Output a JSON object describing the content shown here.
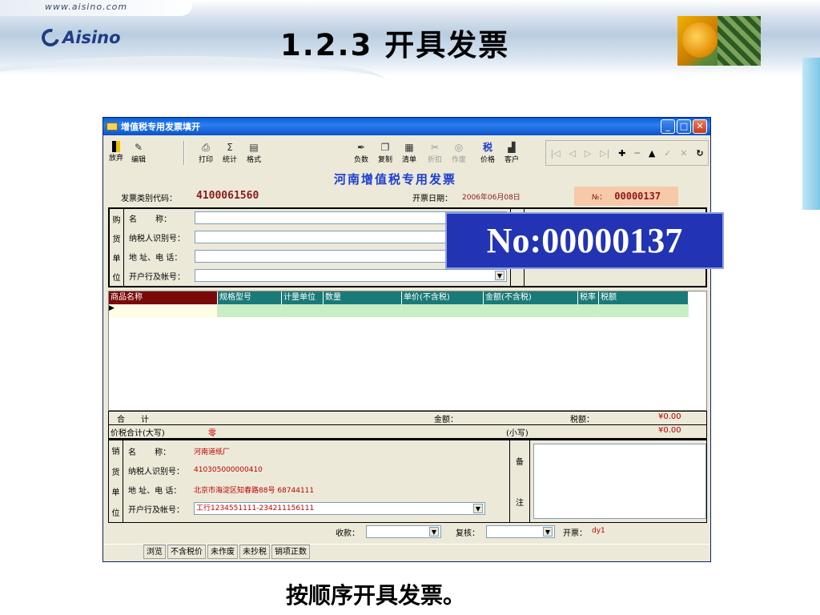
{
  "slide": {
    "url": "www.aisino.com",
    "logo": "Aisino",
    "title": "1.2.3 开具发票",
    "caption": "按顺序开具发票。"
  },
  "window": {
    "title": "增值税专用发票填开",
    "controls": {
      "minimize": "_",
      "maximize": "□",
      "close": "✕"
    }
  },
  "toolbar": {
    "discard": "放弃",
    "edit": "编辑",
    "print": "打印",
    "stats": "统计",
    "format": "格式",
    "negative": "负数",
    "copy": "复制",
    "list": "清单",
    "discount": "折扣",
    "void": "作废",
    "price": "价格",
    "customer": "客户",
    "nav_symbols": [
      "|◁",
      "◁",
      "▷",
      "▷|",
      "✚",
      "━",
      "▲",
      "✓",
      "✕",
      "↻"
    ]
  },
  "invoice": {
    "heading": "河南增值税专用发票",
    "code_label": "发票类别代码：",
    "code_value": "4100061560",
    "date_label": "开票日期：",
    "date_value": "2006年06月08日",
    "no_label": "№：",
    "no_value": "00000137"
  },
  "buyer": {
    "side_chars": [
      "购",
      "货",
      "单",
      "位"
    ],
    "name_label": "名　　 称：",
    "taxid_label": "纳税人识别号：",
    "addr_label": "地 址、电 话：",
    "bank_label": "开户行及帐号：",
    "dropdown": "▼"
  },
  "items": {
    "columns": [
      "商品名称",
      "规格型号",
      "计量单位",
      "数量",
      "单价(不含税)",
      "金额(不含税)",
      "税率",
      "税额"
    ],
    "row_marker": "▶"
  },
  "totals": {
    "sum_label": "合　　计",
    "amount_label": "金额：",
    "tax_label": "税额：",
    "sum_value": "¥0.00",
    "total_label": "价税合计(大写)",
    "total_caps": "零",
    "small_label": "(小写)",
    "total_value": "¥0.00"
  },
  "seller": {
    "side_chars": [
      "销",
      "货",
      "单",
      "位"
    ],
    "name_label": "名　　 称：",
    "name_value": "河南道纸厂",
    "taxid_label": "纳税人识别号：",
    "taxid_value": "410305000000410",
    "addr_label": "地 址、电 话：",
    "addr_value": "北京市海淀区知春路88号 68744111",
    "bank_label": "开户行及帐号：",
    "bank_value": "工行1234551111-234211156111",
    "remarks_chars": [
      "备",
      "注"
    ]
  },
  "footer": {
    "receiver_label": "收款：",
    "reviewer_label": "复核：",
    "issuer_label": "开票：",
    "issuer_value": "dy1"
  },
  "status": [
    "浏览",
    "不含税价",
    "未作废",
    "未抄税",
    "销项正数"
  ],
  "callout": "No:00000137"
}
